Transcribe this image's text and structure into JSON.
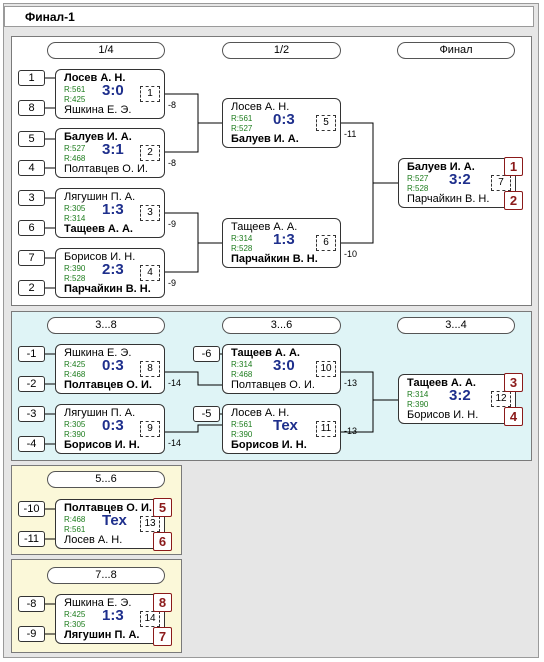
{
  "title": "Финал-1",
  "sections": {
    "main": {
      "headers": [
        "1/4",
        "1/2",
        "Финал"
      ],
      "seeds": [
        "1",
        "8",
        "5",
        "4",
        "3",
        "6",
        "7",
        "2"
      ],
      "matches": [
        {
          "top": "Лосев А. Н.",
          "top_bold": true,
          "r1": "R:561",
          "r2": "R:425",
          "score": "3:0",
          "no": "1",
          "bot": "Яшкина Е. Э.",
          "bot_bold": false,
          "link": "-8"
        },
        {
          "top": "Балуев И. А.",
          "top_bold": true,
          "r1": "R:527",
          "r2": "R:468",
          "score": "3:1",
          "no": "2",
          "bot": "Полтавцев О. И.",
          "bot_bold": false,
          "link": "-8"
        },
        {
          "top": "Лягушин П. А.",
          "top_bold": false,
          "r1": "R:305",
          "r2": "R:314",
          "score": "1:3",
          "no": "3",
          "bot": "Тащеев А. А.",
          "bot_bold": true,
          "link": "-9"
        },
        {
          "top": "Борисов И. Н.",
          "top_bold": false,
          "r1": "R:390",
          "r2": "R:528",
          "score": "2:3",
          "no": "4",
          "bot": "Парчайкин В. Н.",
          "bot_bold": true,
          "link": "-9"
        },
        {
          "top": "Лосев А. Н.",
          "top_bold": false,
          "r1": "R:561",
          "r2": "R:527",
          "score": "0:3",
          "no": "5",
          "bot": "Балуев И. А.",
          "bot_bold": true,
          "link": "-11"
        },
        {
          "top": "Тащеев А. А.",
          "top_bold": false,
          "r1": "R:314",
          "r2": "R:528",
          "score": "1:3",
          "no": "6",
          "bot": "Парчайкин В. Н.",
          "bot_bold": true,
          "link": "-10"
        },
        {
          "top": "Балуев И. А.",
          "top_bold": true,
          "r1": "R:527",
          "r2": "R:528",
          "score": "3:2",
          "no": "7",
          "bot": "Парчайкин В. Н.",
          "bot_bold": false,
          "place1": "1",
          "place2": "2"
        }
      ]
    },
    "s38": {
      "headers": [
        "3...8",
        "3...6",
        "3...4"
      ],
      "seeds": [
        "-1",
        "-2",
        "-3",
        "-4",
        "-6",
        "-5"
      ],
      "matches": [
        {
          "top": "Яшкина Е. Э.",
          "top_bold": false,
          "r1": "R:425",
          "r2": "R:468",
          "score": "0:3",
          "no": "8",
          "bot": "Полтавцев О. И.",
          "bot_bold": true,
          "link": "-14"
        },
        {
          "top": "Лягушин П. А.",
          "top_bold": false,
          "r1": "R:305",
          "r2": "R:390",
          "score": "0:3",
          "no": "9",
          "bot": "Борисов И. Н.",
          "bot_bold": true,
          "link": "-14"
        },
        {
          "top": "Тащеев А. А.",
          "top_bold": true,
          "r1": "R:314",
          "r2": "R:468",
          "score": "3:0",
          "no": "10",
          "bot": "Полтавцев О. И.",
          "bot_bold": false,
          "link": "-13"
        },
        {
          "top": "Лосев А. Н.",
          "top_bold": false,
          "r1": "R:561",
          "r2": "R:390",
          "score": "Тех",
          "no": "11",
          "bot": "Борисов И. Н.",
          "bot_bold": true,
          "link": "-13"
        },
        {
          "top": "Тащеев А. А.",
          "top_bold": true,
          "r1": "R:314",
          "r2": "R:390",
          "score": "3:2",
          "no": "12",
          "bot": "Борисов И. Н.",
          "bot_bold": false,
          "place1": "3",
          "place2": "4"
        }
      ]
    },
    "s56": {
      "header": "5...6",
      "seeds": [
        "-10",
        "-11"
      ],
      "match": {
        "top": "Полтавцев О. И.",
        "top_bold": true,
        "r1": "R:468",
        "r2": "R:561",
        "score": "Тех",
        "no": "13",
        "bot": "Лосев А. Н.",
        "bot_bold": false,
        "place1": "5",
        "place2": "6"
      }
    },
    "s78": {
      "header": "7...8",
      "seeds": [
        "-8",
        "-9"
      ],
      "match": {
        "top": "Яшкина Е. Э.",
        "top_bold": false,
        "r1": "R:425",
        "r2": "R:305",
        "score": "1:3",
        "no": "14",
        "bot": "Лягушин П. А.",
        "bot_bold": true,
        "place1": "8",
        "place2": "7"
      }
    }
  },
  "colors": {
    "score": "#1e2f8c",
    "rating": "#1e7d1e",
    "place": "#8b1a1a",
    "main_bg": "#ffffff",
    "s38_bg": "#dff4f6",
    "low_bg": "#fbf8d9"
  }
}
